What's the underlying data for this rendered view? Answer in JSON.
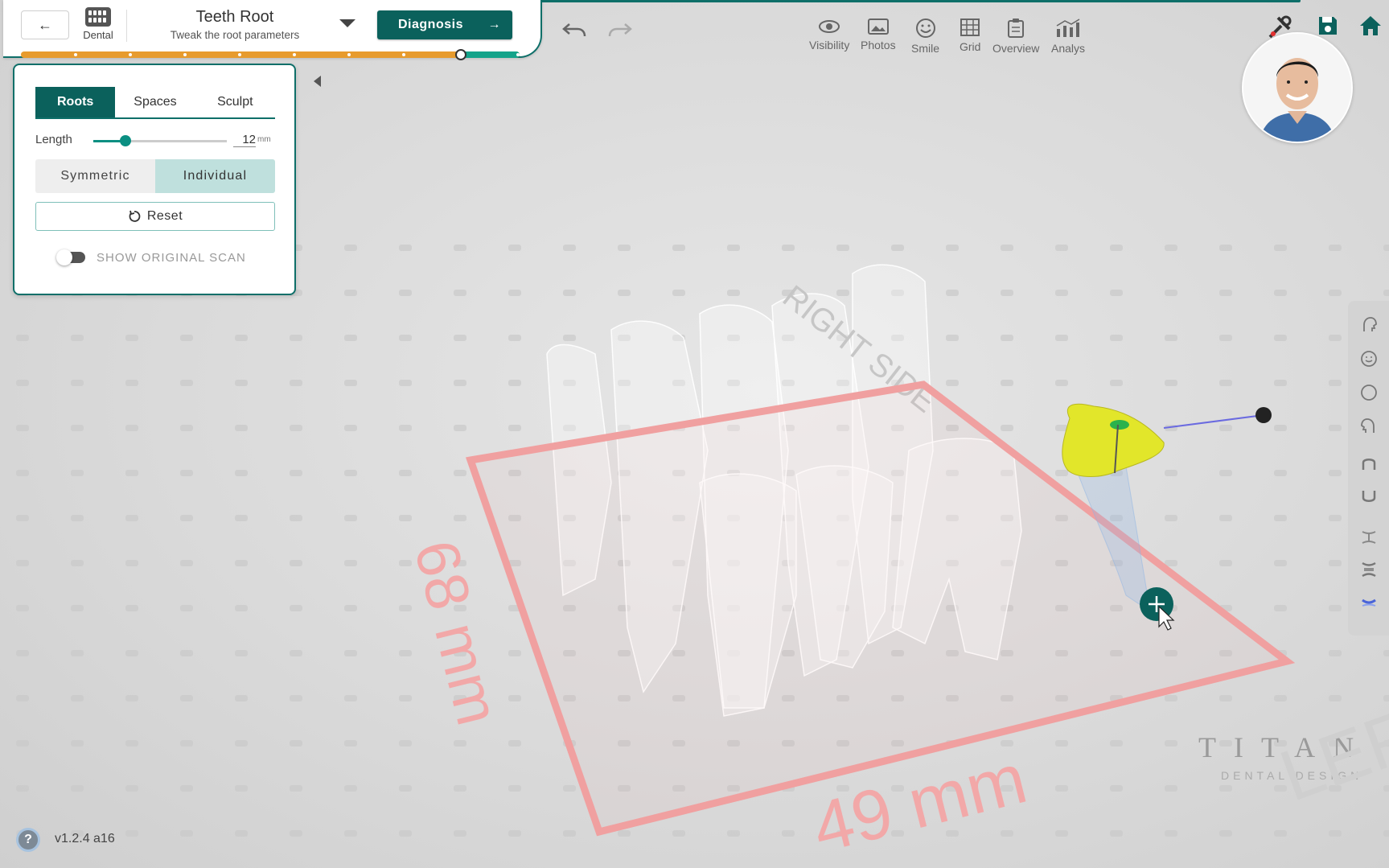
{
  "header": {
    "back_icon": "arrow-left-icon",
    "dental_label": "Dental",
    "step_title": "Teeth Root",
    "step_subtitle": "Tweak the root parameters",
    "next_button_label": "Diagnosis",
    "progress_steps": 10,
    "progress_current": 9
  },
  "toolbar": {
    "visibility": "Visibility",
    "photos": "Photos",
    "smile": "Smile",
    "grid": "Grid",
    "overview": "Overview",
    "analysis": "Analys"
  },
  "panel": {
    "tabs": [
      "Roots",
      "Spaces",
      "Sculpt"
    ],
    "active_tab": "Roots",
    "length_label": "Length",
    "length_value": "12",
    "length_unit": "mm",
    "length_fraction": 0.24,
    "mode_options": [
      "Symmetric",
      "Individual"
    ],
    "active_mode": "Individual",
    "reset_label": "Reset",
    "show_original_label": "SHOW ORIGINAL SCAN",
    "show_original_on": false
  },
  "scene": {
    "dimension_depth": "68 mm",
    "dimension_width": "49 mm",
    "side_label": "RIGHT SIDE",
    "side_label_2": "LEFT"
  },
  "footer": {
    "version": "v1.2.4 a16",
    "help_icon": "question-icon"
  },
  "branding": {
    "logo_main": "TITAN",
    "logo_sub": "DENTAL DESIGN"
  },
  "colors": {
    "primary": "#0b615c",
    "progress": "#e79b2e",
    "progress_done": "#14a38a",
    "bounding_box": "#f08a8a",
    "selected_tooth": "#e2e62a"
  }
}
